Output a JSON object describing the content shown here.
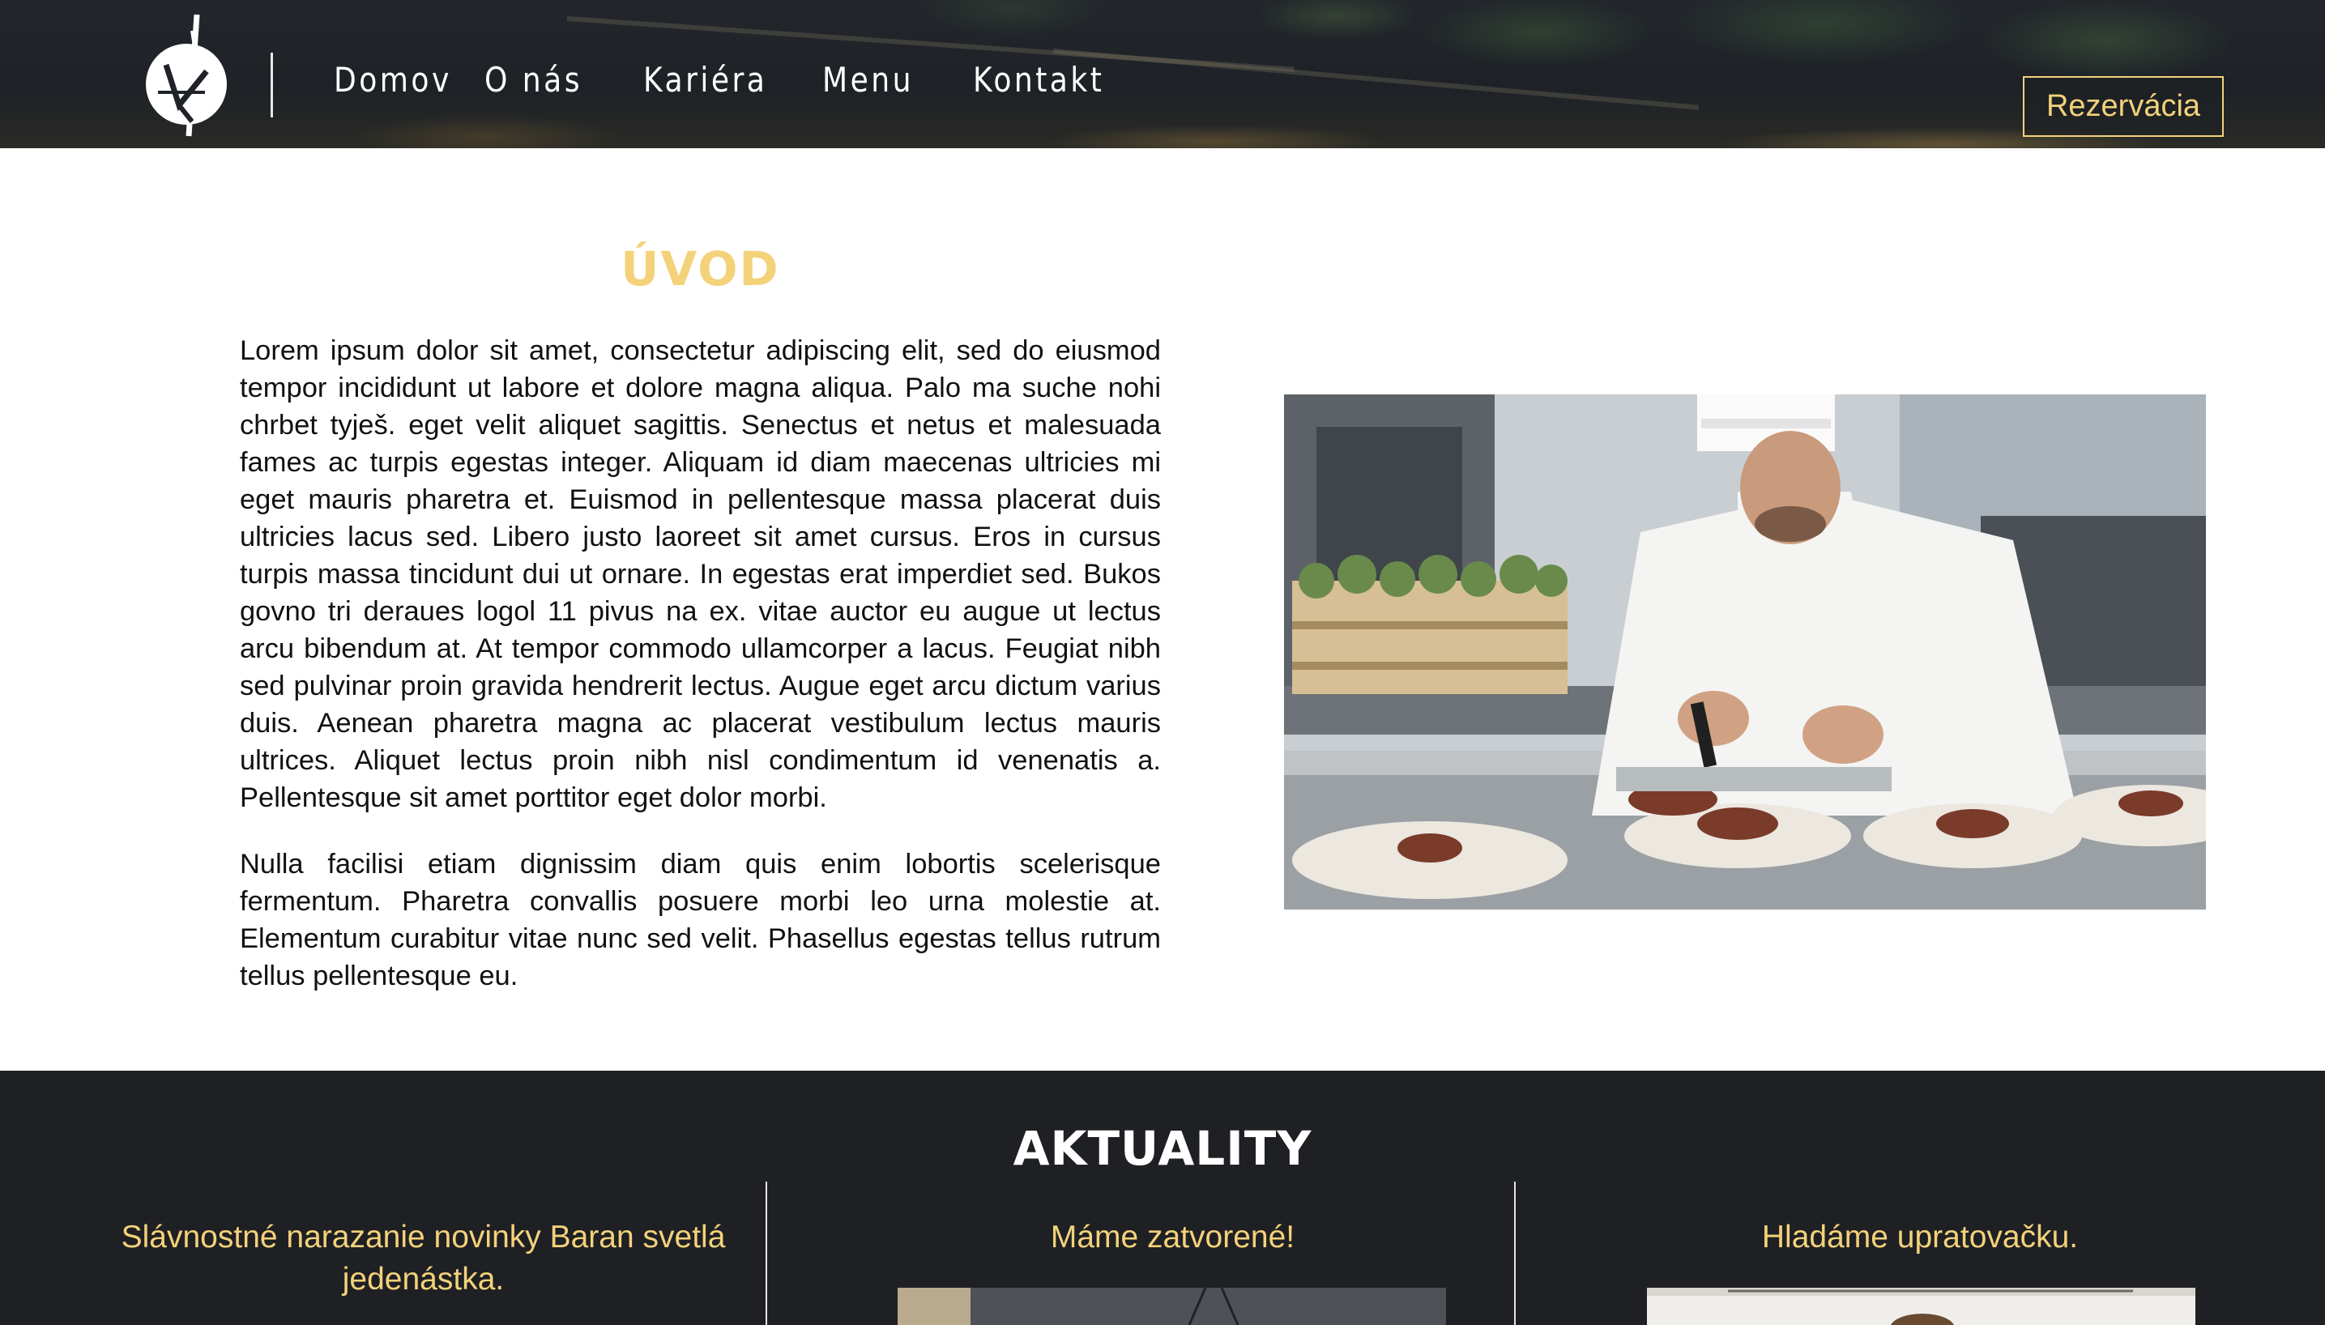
{
  "header": {
    "nav": [
      "Domov",
      "O nás",
      "Kariéra",
      "Menu",
      "Kontakt"
    ],
    "reserve_label": "Rezervácia"
  },
  "intro": {
    "title": "ÚVOD",
    "paragraphs": [
      "Lorem ipsum dolor sit amet, consectetur adipiscing elit, sed do eiusmod tempor incididunt ut labore et dolore magna aliqua. Palo ma suche nohi chrbet tyješ. eget velit aliquet sagittis. Senectus et netus et malesuada fames ac turpis egestas integer. Aliquam id diam maecenas ultricies mi eget mauris pharetra et. Euismod in pellentesque massa placerat duis ultricies lacus sed. Libero justo laoreet sit amet cursus. Eros in cursus turpis massa tincidunt dui ut ornare. In egestas erat imperdiet sed. Bukos govno tri deraues logol 11 pivus na ex. vitae auctor eu augue ut lectus arcu bibendum at. At tempor commodo ullamcorper a lacus. Feugiat nibh sed pulvinar proin gravida hendrerit lectus. Augue eget arcu dictum varius duis. Aenean pharetra magna ac placerat vestibulum lectus mauris ultrices. Aliquet lectus proin nibh nisl condimentum id venenatis a. Pellentesque sit amet porttitor eget dolor morbi.",
      "Nulla facilisi etiam dignissim diam quis enim lobortis scelerisque fermentum. Pharetra convallis posuere morbi leo urna molestie at. Elementum curabitur vitae nunc sed velit. Phasellus egestas tellus rutrum tellus pellentesque eu."
    ]
  },
  "news": {
    "title": "AKTUALITY",
    "items": [
      {
        "title": "Slávnostné narazanie novinky Baran svetlá jedenástka."
      },
      {
        "title": "Máme zatvorené!"
      },
      {
        "title": "Hladáme upratovačku."
      }
    ]
  },
  "colors": {
    "accent": "#f3d27a",
    "dark": "#1f2024"
  }
}
